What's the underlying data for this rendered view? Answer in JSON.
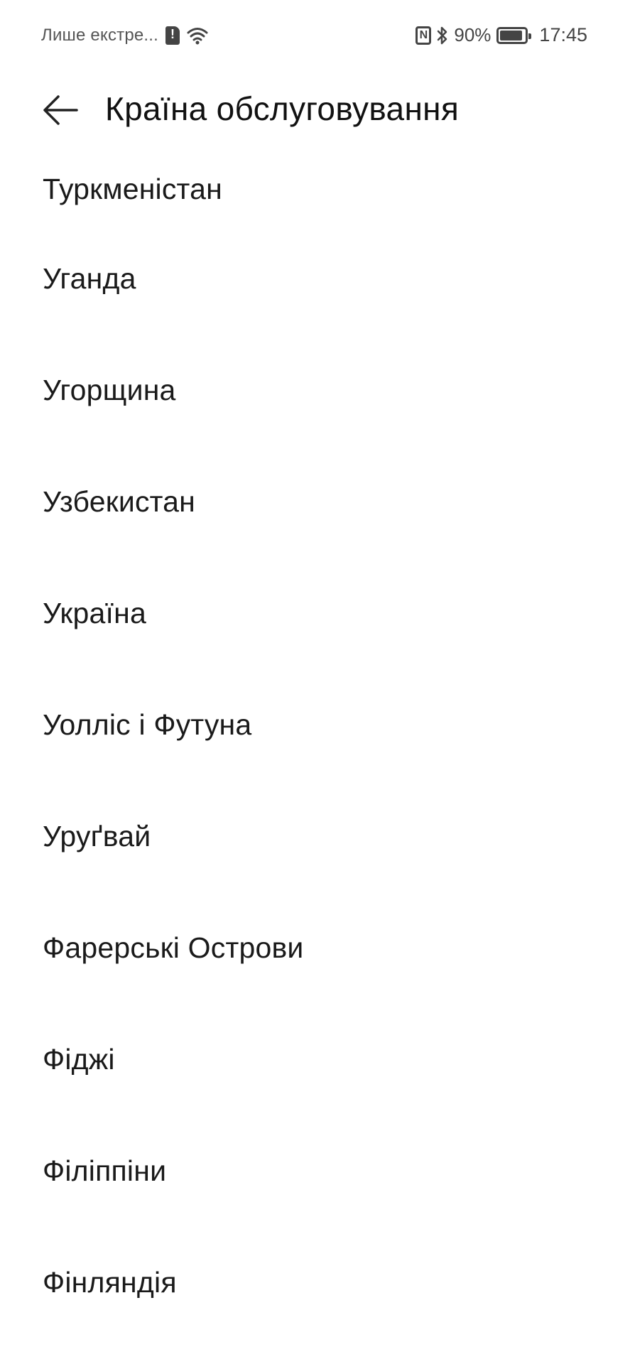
{
  "status_bar": {
    "carrier": "Лише екстре...",
    "battery_percent": "90%",
    "battery_level": 0.9,
    "time": "17:45",
    "icons": [
      "sim-alert-icon",
      "wifi-icon",
      "nfc-icon",
      "bluetooth-icon",
      "battery-icon"
    ]
  },
  "header": {
    "back_icon": "arrow-left-icon",
    "title": "Країна обслуговування"
  },
  "countries": [
    "Туркменістан",
    "Уганда",
    "Угорщина",
    "Узбекистан",
    "Україна",
    "Уолліс і Футуна",
    "Уруґвай",
    "Фарерські Острови",
    "Фіджі",
    "Філіппіни",
    "Фінляндія"
  ]
}
